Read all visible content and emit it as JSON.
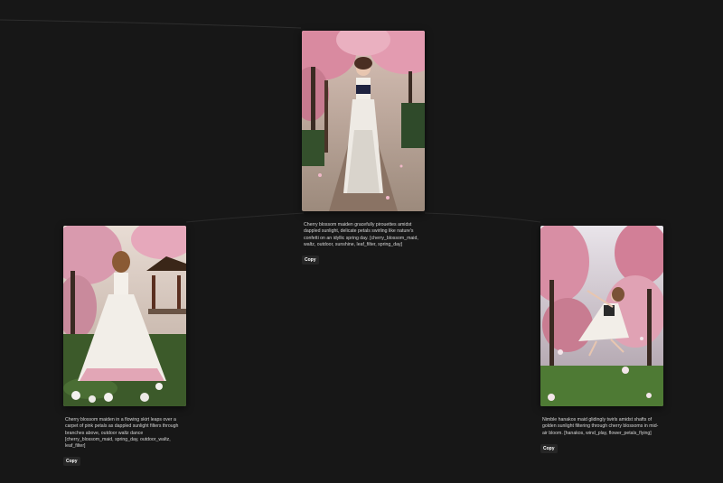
{
  "cards": [
    {
      "caption": "Cherry blossom maiden gracefully pirouettes amidst dappled sunlight, delicate petals swirling like nature's confetti on an idyllic spring day. [cherry_blossom_maid, waltz, outdoor, sunshine, leaf_filter, spring_day]",
      "copy_label": "Copy",
      "image": "cherry-blossom-maid-walking-path"
    },
    {
      "caption": "Cherry blossom maiden in a flowing skirt leaps over a carpet of pink petals as dappled sunlight filters through branches above, outdoor waltz dance [cherry_blossom_maid, spring_day, outdoor_waltz, leaf_filter]",
      "copy_label": "Copy",
      "image": "cherry-blossom-maid-pavilion-garden"
    },
    {
      "caption": "Nimble hanakos maid glidingly twirls amidst shafts of golden sunlight filtering through cherry blossoms in mid-air bloom. [hanakos, wind_play, flower_petals_flying]",
      "copy_label": "Copy",
      "image": "hanakos-maid-leaping-petals"
    }
  ],
  "colors": {
    "background": "#171717",
    "blossom": "#e8a0b4",
    "button": "#262626",
    "caption_text": "#d6d6d6"
  }
}
